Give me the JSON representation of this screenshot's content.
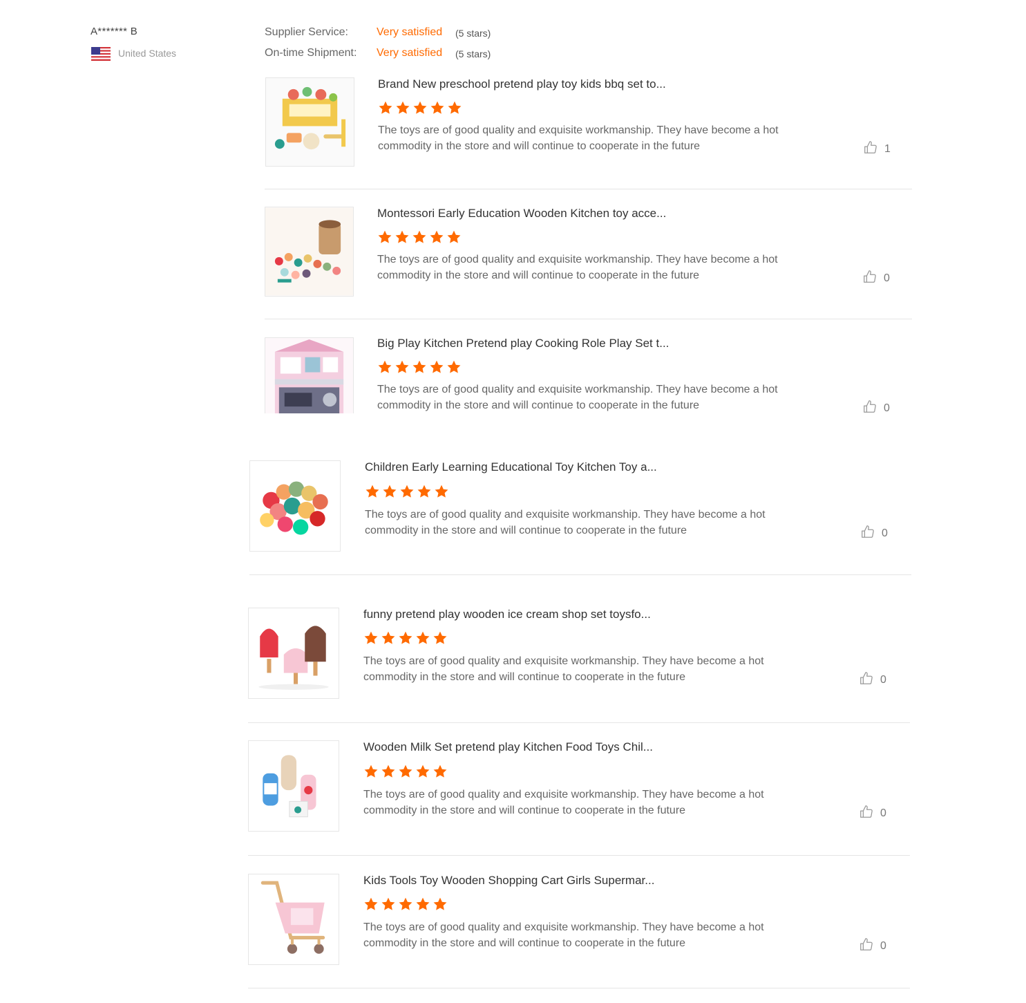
{
  "reviewer": {
    "name": "A******* B",
    "country": "United States"
  },
  "supplier_ratings": [
    {
      "label": "Supplier Service:",
      "value": "Very satisfied",
      "stars_text": "(5 stars)"
    },
    {
      "label": "On-time Shipment:",
      "value": "Very satisfied",
      "stars_text": "(5 stars)"
    }
  ],
  "reviews": [
    {
      "product_title": "Brand New preschool pretend play toy kids bbq set to...",
      "rating": 5,
      "text": "The toys are of good quality and exquisite workmanship. They have become a hot commodity in the store and will continue to cooperate in the future",
      "likes": "1",
      "image_icon": "bbq-set-product-image"
    },
    {
      "product_title": "Montessori Early Education Wooden Kitchen toy acce...",
      "rating": 5,
      "text": "The toys are of good quality and exquisite workmanship. They have become a hot commodity in the store and will continue to cooperate in the future",
      "likes": "0",
      "image_icon": "kitchen-accessories-product-image"
    },
    {
      "product_title": "Big Play Kitchen Pretend play Cooking Role Play Set t...",
      "rating": 5,
      "text": "The toys are of good quality and exquisite workmanship. They have become a hot commodity in the store and will continue to cooperate in the future",
      "likes": "0",
      "image_icon": "play-kitchen-product-image"
    },
    {
      "product_title": "Children Early Learning Educational Toy Kitchen Toy a...",
      "rating": 5,
      "text": "The toys are of good quality and exquisite workmanship. They have become a hot commodity in the store and will continue to cooperate in the future",
      "likes": "0",
      "image_icon": "toy-food-product-image"
    },
    {
      "product_title": "funny pretend play wooden ice cream shop set toysfo...",
      "rating": 5,
      "text": "The toys are of good quality and exquisite workmanship. They have become a hot commodity in the store and will continue to cooperate in the future",
      "likes": "0",
      "image_icon": "ice-cream-product-image"
    },
    {
      "product_title": "Wooden Milk Set pretend play Kitchen Food Toys Chil...",
      "rating": 5,
      "text": "The toys are of good quality and exquisite workmanship. They have become a hot commodity in the store and will continue to cooperate in the future",
      "likes": "0",
      "image_icon": "milk-set-product-image"
    },
    {
      "product_title": "Kids Tools Toy Wooden Shopping Cart Girls Supermar...",
      "rating": 5,
      "text": "The toys are of good quality and exquisite workmanship. They have become a hot commodity in the store and will continue to cooperate in the future",
      "likes": "0",
      "image_icon": "shopping-cart-product-image"
    }
  ],
  "colors": {
    "accent": "#ff6a00",
    "star": "#ff6a00",
    "divider": "#e5e5e5"
  }
}
